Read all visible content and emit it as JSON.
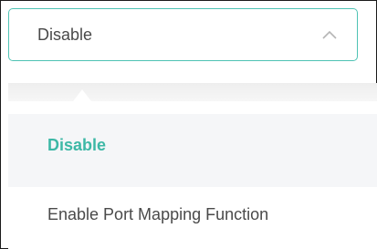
{
  "select": {
    "value": "Disable",
    "expanded_icon": "chevron-up-icon"
  },
  "options": [
    {
      "label": "Disable",
      "selected": true
    },
    {
      "label": "Enable Port Mapping Function",
      "selected": false
    }
  ],
  "colors": {
    "accent": "#3db8a6",
    "border": "#4fc3b4",
    "text": "#4a4a4a",
    "selected_bg": "#f5f6f8"
  }
}
